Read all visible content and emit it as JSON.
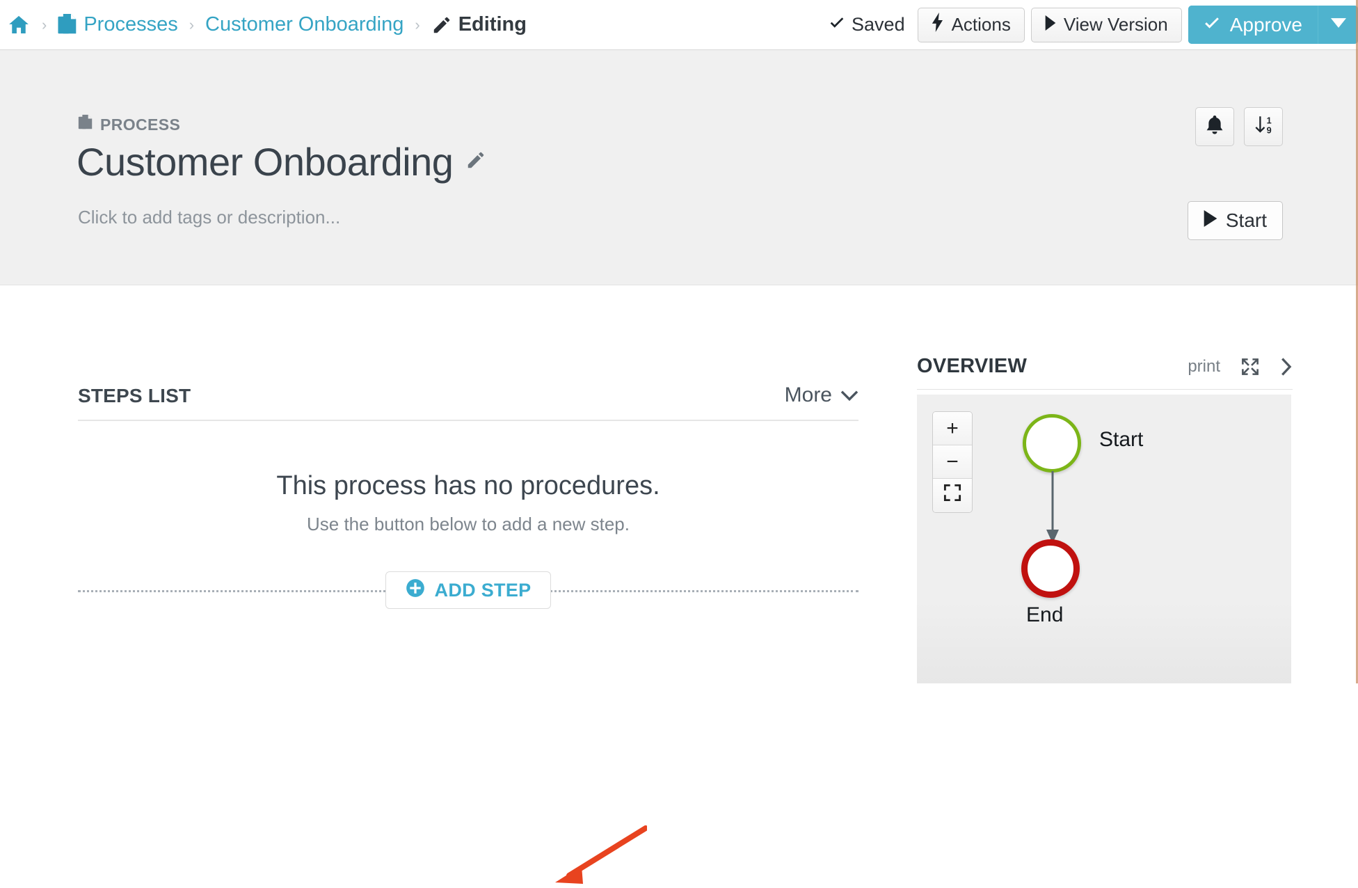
{
  "topbar": {
    "breadcrumb": [
      {
        "icon": "home-icon",
        "label": ""
      },
      {
        "icon": "documents-icon",
        "label": "Processes"
      },
      {
        "icon": "",
        "label": "Customer Onboarding"
      },
      {
        "icon": "pencil-icon",
        "label": "Editing"
      }
    ],
    "separator": "›",
    "saved_label": "Saved",
    "saved_icon": "check-icon",
    "actions_label": "Actions",
    "actions_icon": "bolt-icon",
    "view_version_label": "View Version",
    "view_version_icon": "play-triangle-icon",
    "approve_label": "Approve",
    "approve_icon": "check-icon",
    "approve_caret_icon": "caret-down-icon"
  },
  "pageheader": {
    "kicker": "PROCESS",
    "kicker_icon": "documents-icon",
    "title": "Customer Onboarding",
    "title_edit_icon": "pencil-icon",
    "description_placeholder": "Click to add tags or description...",
    "bell_icon": "bell-icon",
    "sort_icon": "sort-numeric-down-icon",
    "start_label": "Start",
    "start_icon": "play-triangle-icon"
  },
  "steps": {
    "title": "STEPS LIST",
    "more_label": "More",
    "more_icon": "chevron-down-icon",
    "empty_title": "This process has no procedures.",
    "empty_subtitle": "Use the button below to add a new step.",
    "add_step_label": "ADD STEP",
    "add_step_icon": "plus-circle-icon"
  },
  "overview": {
    "title": "OVERVIEW",
    "print_label": "print",
    "expand_icon": "expand-arrows-icon",
    "collapse_icon": "chevron-right-icon",
    "zoom_in": "+",
    "zoom_out": "−",
    "fit_icon": "fit-screen-icon",
    "diagram": {
      "nodes": [
        {
          "id": "start",
          "label": "Start",
          "color": "#7cb518"
        },
        {
          "id": "end",
          "label": "End",
          "color": "#c0110f"
        }
      ],
      "edges": [
        {
          "from": "start",
          "to": "end"
        }
      ]
    }
  },
  "annotation": {
    "arrow_color": "#e8431f",
    "points_to": "add-step-button"
  }
}
